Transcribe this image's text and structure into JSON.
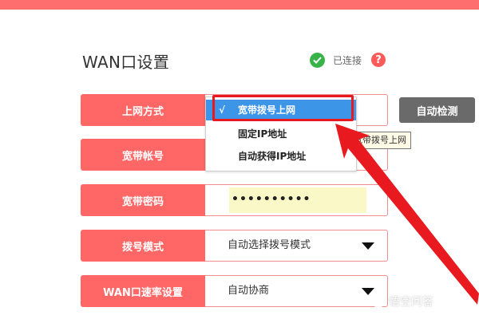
{
  "colors": {
    "accent": "#ff6666",
    "selected": "#3d95e8",
    "highlight": "#e8191f",
    "connected": "#37b34a"
  },
  "page": {
    "title": "WAN口设置"
  },
  "status": {
    "icon": "check-circle-icon",
    "text": "已连接",
    "help_icon": "help-icon",
    "help_glyph": "?"
  },
  "form": {
    "connection_type": {
      "label": "上网方式",
      "detect_button": "自动检测"
    },
    "account": {
      "label": "宽带帐号"
    },
    "password": {
      "label": "宽带密码",
      "value": "••••••••••"
    },
    "dial_mode": {
      "label": "拨号模式",
      "value": "自动选择拨号模式"
    },
    "wan_speed": {
      "label": "WAN口速率设置",
      "value": "自动协商"
    }
  },
  "dropdown": {
    "check_mark": "√",
    "options": [
      "宽带拨号上网",
      "固定IP地址",
      "自动获得IP地址"
    ],
    "selected_index": 0
  },
  "tooltip": {
    "text": "宽带拨号上网"
  },
  "watermark": {
    "text": "悟空问答"
  }
}
